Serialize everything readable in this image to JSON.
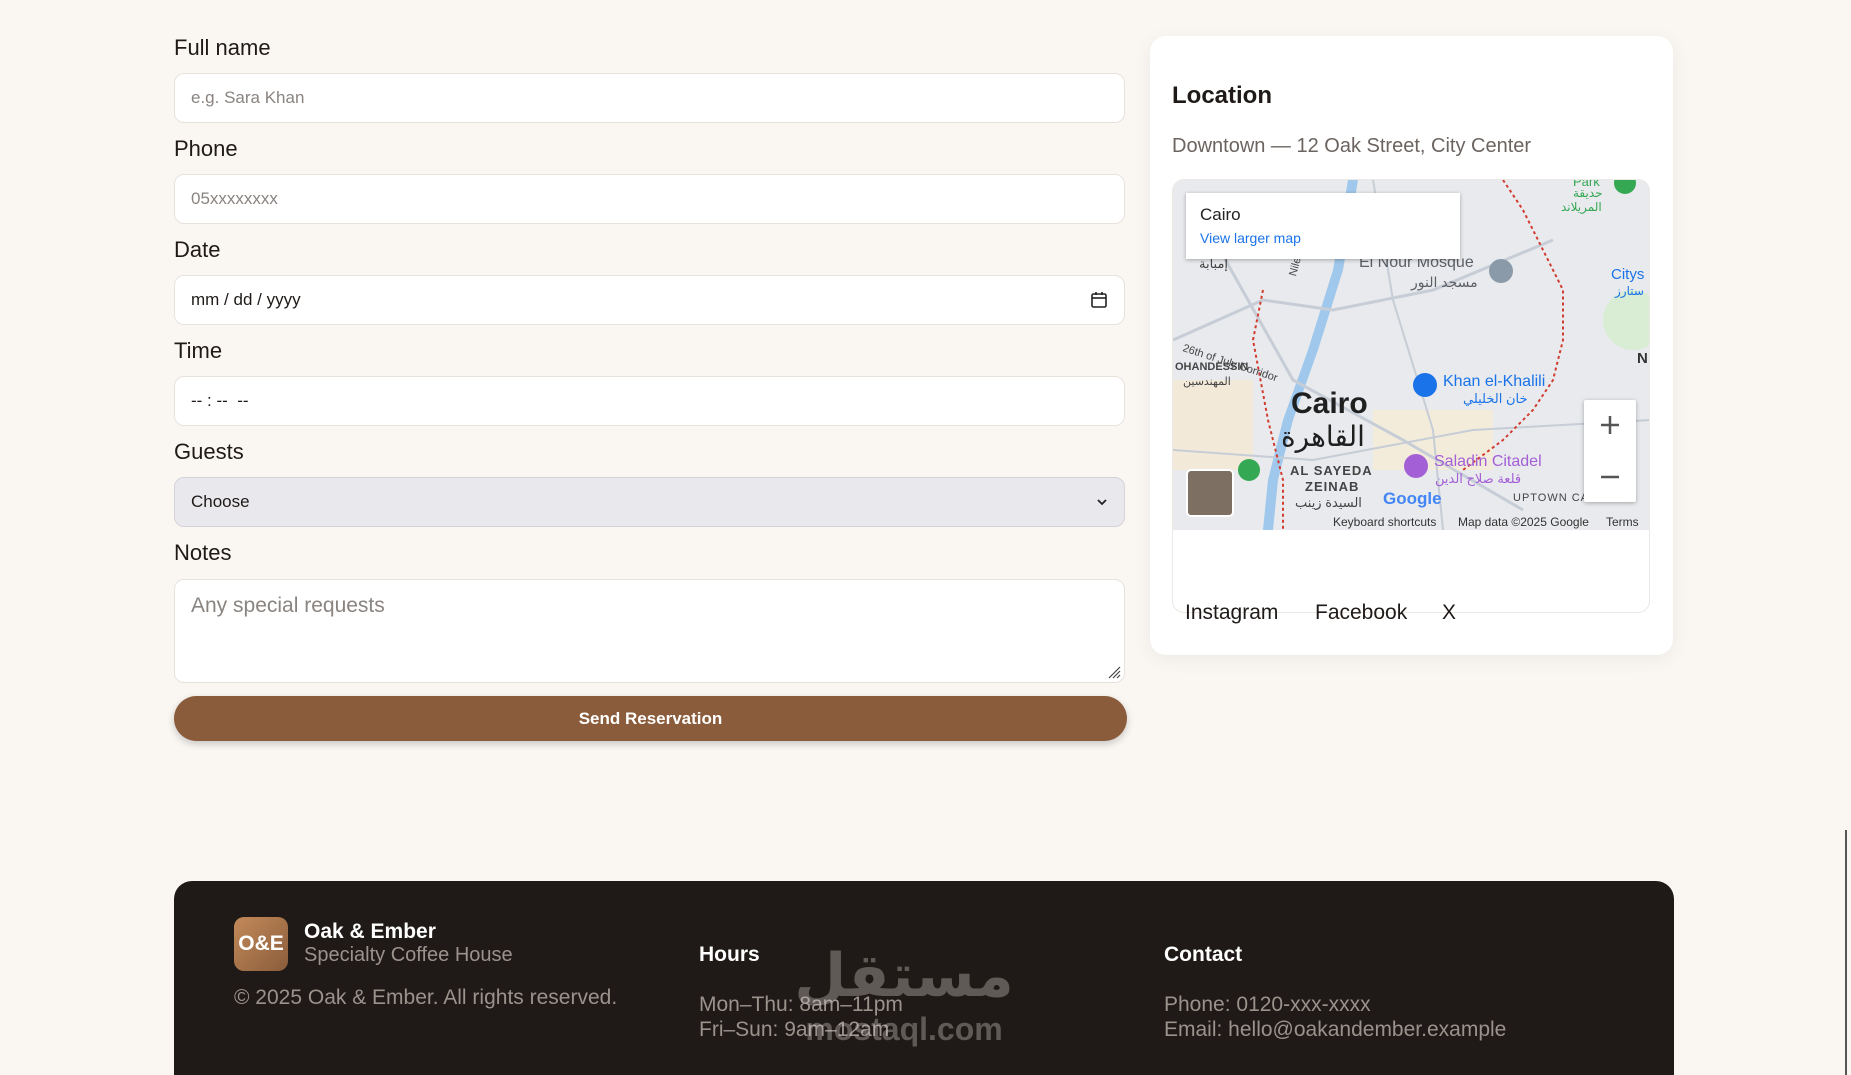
{
  "form": {
    "name_label": "Full name",
    "name_placeholder": "e.g. Sara Khan",
    "phone_label": "Phone",
    "phone_placeholder": "05xxxxxxxx",
    "date_label": "Date",
    "date_value": "mm / dd / yyyy",
    "time_label": "Time",
    "time_value": "-- : --  --",
    "guests_label": "Guests",
    "guests_value": "Choose",
    "notes_label": "Notes",
    "notes_placeholder": "Any special requests",
    "submit_label": "Send Reservation"
  },
  "location": {
    "title": "Location",
    "address": "Downtown — 12 Oak Street, City Center",
    "map": {
      "place": "Cairo",
      "larger_link": "View larger map",
      "labels": [
        "El Nour Mosque",
        "مسجد النور",
        "Cairo",
        "القاهرة",
        "Khan el-Khalili",
        "خان الخليلي",
        "Saladin Citadel",
        "قلعة صلاح الدين",
        "AL SAYEDA",
        "ZEINAB",
        "السيدة زينب",
        "26th of July Corridor",
        "OHANDESSIN",
        "المهندسين",
        "Nile Co",
        "إمبابة",
        "UPTOWN CAIRO",
        "Park",
        "حديقة",
        "المريلاند",
        "Citys",
        "ستارز",
        "N"
      ],
      "keyboard": "Keyboard shortcuts",
      "mapdata": "Map data ©2025 Google",
      "terms": "Terms",
      "google": "Google"
    },
    "social": [
      "Instagram",
      "Facebook",
      "X"
    ]
  },
  "footer": {
    "logo": "O&E",
    "brand": "Oak & Ember",
    "tagline": "Specialty Coffee House",
    "copyright": "© 2025 Oak & Ember. All rights reserved.",
    "hours_title": "Hours",
    "hours": [
      "Mon–Thu: 8am–11pm",
      "Fri–Sun: 9am–12am"
    ],
    "contact_title": "Contact",
    "phone": "Phone: 0120-xxx-xxxx",
    "email": "Email: hello@oakandember.example"
  },
  "watermark": {
    "arabic": "مستقل",
    "latin": "mostaql.com"
  },
  "colors": {
    "accent": "#8a5c3b",
    "background": "#faf7f3",
    "footer": "#1f1a17"
  }
}
